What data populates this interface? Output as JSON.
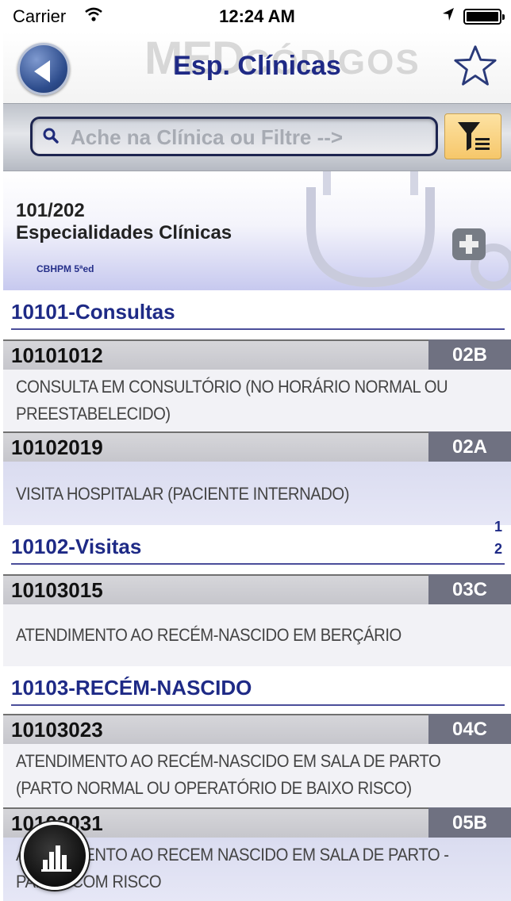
{
  "status_bar": {
    "carrier": "Carrier",
    "time": "12:24 AM"
  },
  "nav": {
    "logo_big": "MED",
    "logo_small": "CÓDIGOS",
    "title": "Esp. Clínicas"
  },
  "search": {
    "placeholder": "Ache na Clínica ou Filtre -->"
  },
  "section": {
    "code": "101/202",
    "name": "Especialidades Clínicas",
    "source": "CBHPM 5ªed"
  },
  "groups": [
    {
      "label": "10101-Consultas"
    },
    {
      "label": "10102-Visitas"
    },
    {
      "label": "10103-RECÉM-NASCIDO"
    }
  ],
  "procedures": [
    {
      "code": "10101012",
      "porte": "02B",
      "desc": "CONSULTA EM CONSULTÓRIO (NO HORÁRIO NORMAL OU PREESTABELECIDO)"
    },
    {
      "code": "10102019",
      "porte": "02A",
      "desc": "VISITA HOSPITALAR (PACIENTE INTERNADO)"
    },
    {
      "code": "10103015",
      "porte": "03C",
      "desc": "ATENDIMENTO AO RECÉM-NASCIDO EM BERÇÁRIO"
    },
    {
      "code": "10103023",
      "porte": "04C",
      "desc": "ATENDIMENTO AO RECÉM-NASCIDO EM SALA DE PARTO (PARTO NORMAL OU OPERATÓRIO DE BAIXO RISCO)"
    },
    {
      "code": "10103031",
      "porte": "05B",
      "desc": "ATENDIMENTO AO RECEM NASCIDO EM SALA DE PARTO - PARTO COM RISCO"
    }
  ],
  "index": [
    "1",
    "2"
  ],
  "icons": {
    "back": "back-arrow-icon",
    "favorite": "star-icon",
    "search": "search-icon",
    "filter": "filter-icon",
    "medkit": "medkit-icon",
    "stats": "bar-chart-icon"
  },
  "colors": {
    "title": "#1f2a86",
    "porte_bg": "#6f7181",
    "accent_lilac": "#c7c9ef"
  }
}
